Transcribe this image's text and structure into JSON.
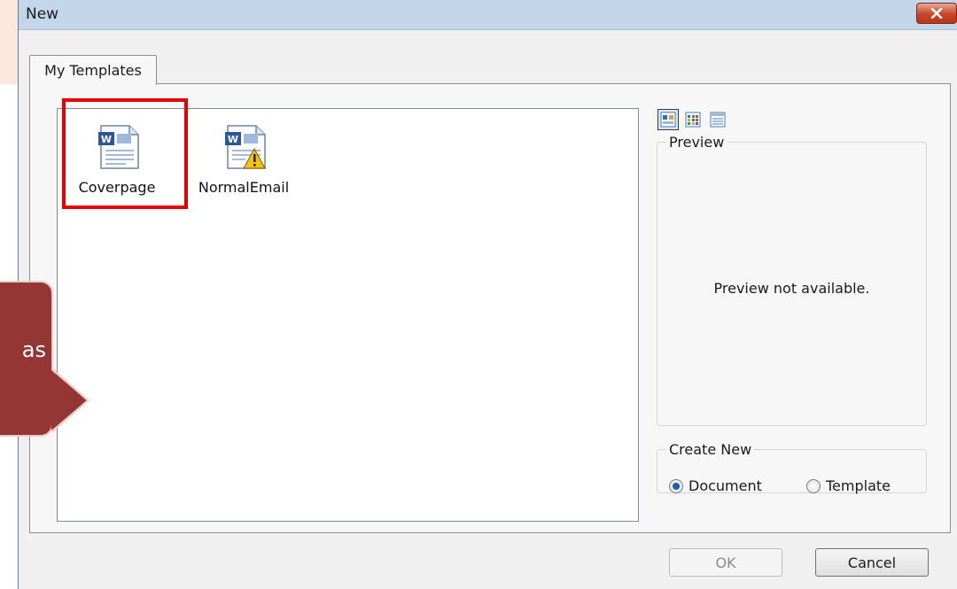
{
  "window": {
    "title": "New"
  },
  "tabs": [
    {
      "label": "My Templates",
      "selected": true
    }
  ],
  "templates": [
    {
      "label": "Coverpage",
      "icon": "word-document-icon",
      "selected": true
    },
    {
      "label": "NormalEmail",
      "icon": "word-email-template-icon",
      "selected": false
    }
  ],
  "view_buttons": [
    {
      "icon": "large-icons-view-icon",
      "active": true
    },
    {
      "icon": "list-view-icon",
      "active": false
    },
    {
      "icon": "details-view-icon",
      "active": false
    }
  ],
  "preview": {
    "legend": "Preview",
    "message": "Preview not available."
  },
  "create_new": {
    "legend": "Create New",
    "options": [
      {
        "label": "Document",
        "checked": true
      },
      {
        "label": "Template",
        "checked": false
      }
    ]
  },
  "buttons": {
    "ok": "OK",
    "cancel": "Cancel"
  },
  "callout": {
    "text": "as"
  },
  "colors": {
    "selection_outline": "#e60000",
    "callout_fill": "#943634",
    "titlebar": "#c4d6ea"
  }
}
